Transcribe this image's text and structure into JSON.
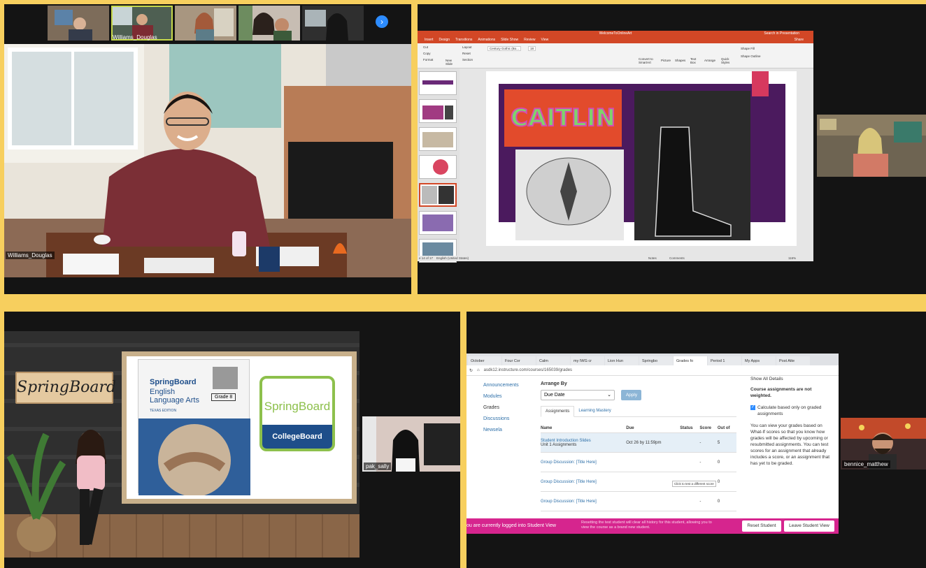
{
  "gallery": {
    "participants": [
      "",
      "Williams_Douglas",
      "",
      "",
      ""
    ],
    "main_name": "Williams_Douglas"
  },
  "ppt": {
    "file_title": "WelcomeToOnlineArt",
    "search_placeholder": "Search in Presentation",
    "share": "Share",
    "tabs": [
      "Insert",
      "Design",
      "Transitions",
      "Animations",
      "Slide Show",
      "Review",
      "View"
    ],
    "ribbon": {
      "cut": "Cut",
      "copy": "Copy",
      "format": "Format",
      "new_slide": "New Slide",
      "layout": "Layout",
      "reset": "Reset",
      "section": "Section",
      "font": "Century Gothic (Bo...",
      "size": "18",
      "convert": "Convert to SmartArt",
      "picture": "Picture",
      "shapes": "Shapes",
      "text_box": "Text Box",
      "arrange": "Arrange",
      "quick_styles": "Quick Styles",
      "shape_fill": "Shape Fill",
      "shape_outline": "Shape Outline"
    },
    "status": {
      "slide": "e 14 of 17",
      "lang": "English (United States)",
      "notes": "Notes",
      "comments": "Comments",
      "zoom": "116%"
    },
    "slide_text": "CAITLIN"
  },
  "springboard": {
    "sign": "SpringBoard",
    "book": {
      "brand": "SpringBoard",
      "subject": "English Language Arts",
      "edition": "TEXAS EDITION",
      "grade": "Grade 8"
    },
    "logo_text": "SpringBoard",
    "logo_sub": "CollegeBoard",
    "side_name": "pak_sally"
  },
  "browser": {
    "tabs": [
      "October",
      "Four Cor",
      "Calm",
      "my IWG cr",
      "Lion Hun",
      "Springbo",
      "Grades fo",
      "Period 1",
      "My Apps",
      "Post Atte"
    ],
    "url": "asdk12.instructure.com/courses/165039/grades"
  },
  "lms": {
    "nav": [
      "Announcements",
      "Modules",
      "Grades",
      "Discussions",
      "Newsela"
    ],
    "arrange_label": "Arrange By",
    "arrange_value": "Due Date",
    "apply": "Apply",
    "subtabs": [
      "Assignments",
      "Learning Mastery"
    ],
    "columns": [
      "Name",
      "Due",
      "Status",
      "Score",
      "Out of"
    ],
    "rows": [
      {
        "name": "Student Introduction Slides",
        "sub": "Unit 1 Assignments",
        "due": "Oct 26 by 11:59pm",
        "score": "-",
        "out": "5"
      },
      {
        "name": "Group Discussion: [Title Here]",
        "sub": "",
        "due": "",
        "score": "-",
        "out": "0"
      },
      {
        "name": "Group Discussion: [Title Here]",
        "sub": "",
        "due": "",
        "score": "-",
        "out": "0"
      },
      {
        "name": "Group Discussion: [Title Here]",
        "sub": "",
        "due": "",
        "score": "-",
        "out": "0"
      }
    ],
    "tooltip": "Click to test a different score",
    "show_all": "Show All Details",
    "course_note": "Course assignments are not weighted.",
    "calc_label": "Calculate based only on graded assignments",
    "whatif": "You can view your grades based on What-If scores so that you know how grades will be affected by upcoming or resubmitted assignments. You can test scores for an assignment that already includes a score, or an assignment that has yet to be graded.",
    "banner_left": "ou are currently logged into Student View",
    "banner_mid": "Resetting the test student will clear all history for this student, allowing you to view the course as a brand new student.",
    "reset": "Reset Student",
    "leave": "Leave Student View",
    "side_name": "bennice_matthew"
  }
}
